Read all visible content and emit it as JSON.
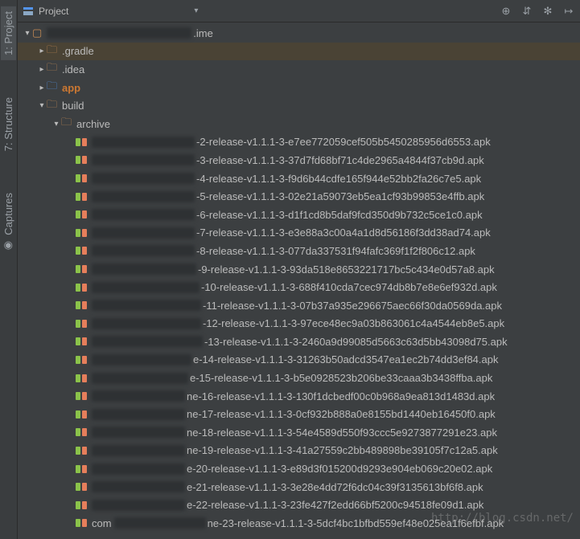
{
  "gutter": {
    "project": "1: Project",
    "structure": "7: Structure",
    "captures": "Captures"
  },
  "header": {
    "title": "Project",
    "icons": {
      "target": "⊕",
      "collapse": "⇵",
      "gear": "✻",
      "more": "↦"
    }
  },
  "tree": {
    "root_suffix": ".ime",
    "folders": {
      "gradle": ".gradle",
      "idea": ".idea",
      "app": "app",
      "build": "build",
      "archive": "archive"
    },
    "files": [
      "-2-release-v1.1.1-3-e7ee772059cef505b5450285956d6553.apk",
      "-3-release-v1.1.1-3-37d7fd68bf71c4de2965a4844f37cb9d.apk",
      "-4-release-v1.1.1-3-f9d6b44cdfe165f944e52bb2fa26c7e5.apk",
      "-5-release-v1.1.1-3-02e21a59073eb5ea1cf93b99853e4ffb.apk",
      "-6-release-v1.1.1-3-d1f1cd8b5daf9fcd350d9b732c5ce1c0.apk",
      "-7-release-v1.1.1-3-e3e88a3c00a4a1d8d56186f3dd38ad74.apk",
      "-8-release-v1.1.1-3-077da337531f94fafc369f1f2f806c12.apk",
      "-9-release-v1.1.1-3-93da518e8653221717bc5c434e0d57a8.apk",
      "-10-release-v1.1.1-3-688f410cda7cec974db8b7e8e6ef932d.apk",
      "-11-release-v1.1.1-3-07b37a935e296675aec66f30da0569da.apk",
      "-12-release-v1.1.1-3-97ece48ec9a03b863061c4a4544eb8e5.apk",
      "-13-release-v1.1.1-3-2460a9d99085d5663c63d5bb43098d75.apk",
      "e-14-release-v1.1.1-3-31263b50adcd3547ea1ec2b74dd3ef84.apk",
      "e-15-release-v1.1.1-3-b5e0928523b206be33caaa3b3438ffba.apk",
      "ne-16-release-v1.1.1-3-130f1dcbedf00c0b968a9ea813d1483d.apk",
      "ne-17-release-v1.1.1-3-0cf932b888a0e8155bd1440eb16450f0.apk",
      "ne-18-release-v1.1.1-3-54e4589d550f93ccc5e9273877291e23.apk",
      "ne-19-release-v1.1.1-3-41a27559c2bb489898be39105f7c12a5.apk",
      "e-20-release-v1.1.1-3-e89d3f015200d9293e904eb069c20e02.apk",
      "e-21-release-v1.1.1-3-3e28e4dd72f6dc04c39f3135613bf6f8.apk",
      "e-22-release-v1.1.1-3-23fe427f2edd66bf5200c94518fe09d1.apk",
      "ne-23-release-v1.1.1-3-5dcf4bc1bfbd559ef48e025ea1f6efbf.apk"
    ],
    "blur_widths": [
      128,
      128,
      128,
      128,
      128,
      128,
      128,
      130,
      134,
      136,
      136,
      138,
      124,
      120,
      116,
      116,
      116,
      116,
      116,
      116,
      116,
      114
    ]
  },
  "watermark": "http://blog.csdn.net/"
}
